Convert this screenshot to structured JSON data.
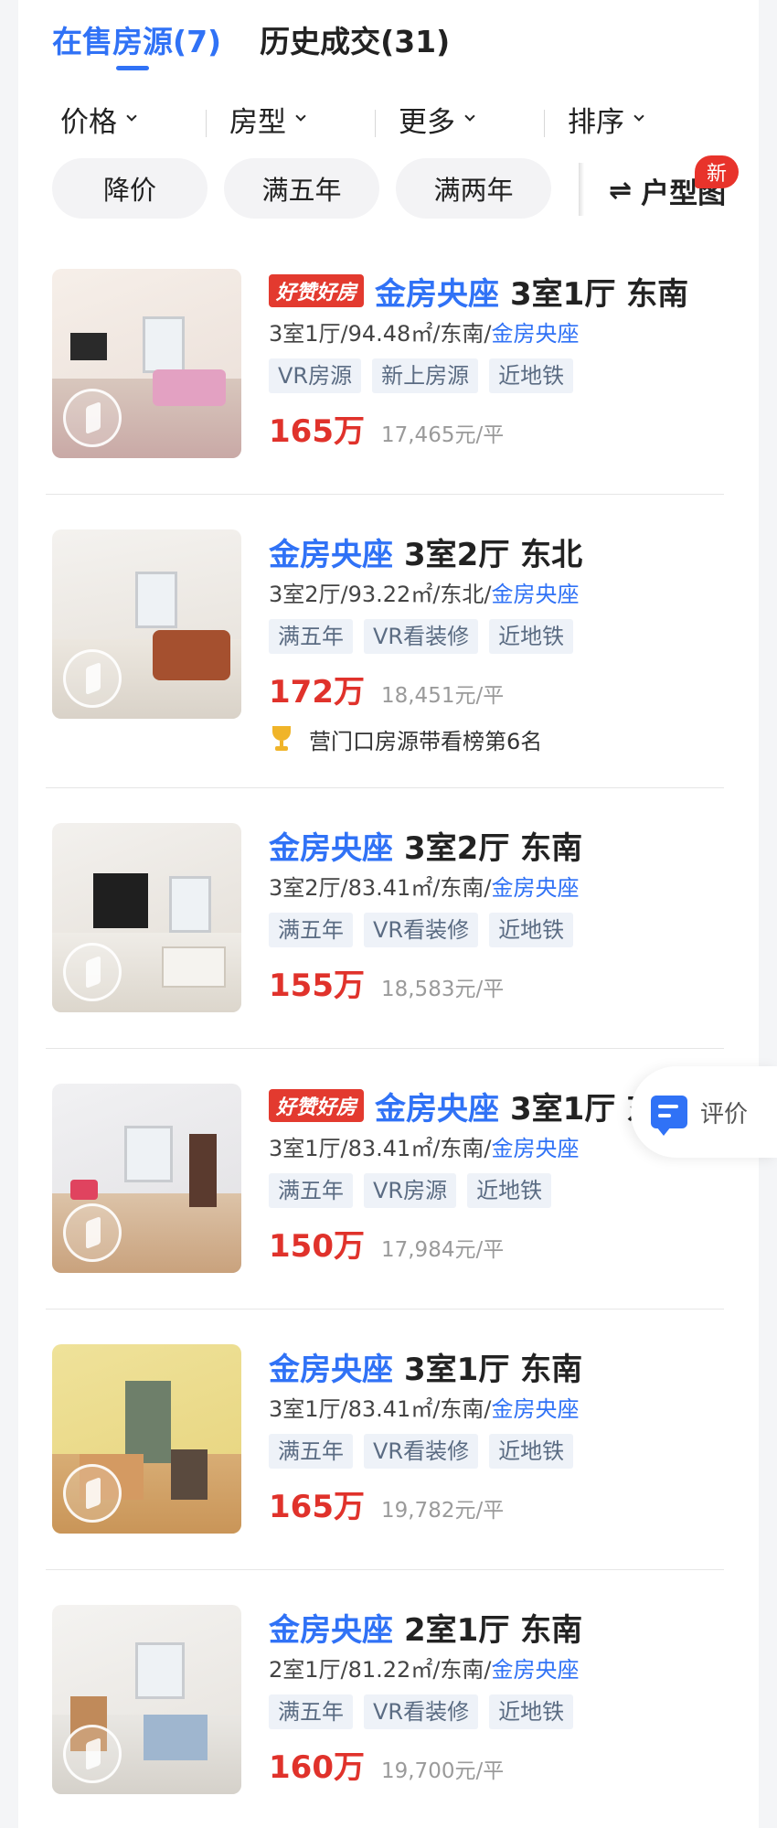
{
  "tabs": [
    {
      "label": "在售房源(7)",
      "active": true
    },
    {
      "label": "历史成交(31)",
      "active": false
    }
  ],
  "filters": [
    {
      "label": "价格"
    },
    {
      "label": "房型"
    },
    {
      "label": "更多"
    },
    {
      "label": "排序"
    }
  ],
  "chips": [
    {
      "label": "降价"
    },
    {
      "label": "满五年"
    },
    {
      "label": "满两年"
    }
  ],
  "floorplan": {
    "icon": "swap-icon",
    "label": "户型图",
    "badge": "新"
  },
  "listings": [
    {
      "hot_badge": "好赞好房",
      "community": "金房央座",
      "layout": "3室1厅 东南",
      "detail_prefix": "3室1厅/94.48㎡/东南/",
      "detail_community": "金房央座",
      "tags": [
        "VR房源",
        "新上房源",
        "近地铁"
      ],
      "price": "165万",
      "unit_price": "17,465元/平"
    },
    {
      "hot_badge": "",
      "community": "金房央座",
      "layout": "3室2厅 东北",
      "detail_prefix": "3室2厅/93.22㎡/东北/",
      "detail_community": "金房央座",
      "tags": [
        "满五年",
        "VR看装修",
        "近地铁"
      ],
      "price": "172万",
      "unit_price": "18,451元/平",
      "rank": "营门口房源带看榜第6名"
    },
    {
      "hot_badge": "",
      "community": "金房央座",
      "layout": "3室2厅 东南",
      "detail_prefix": "3室2厅/83.41㎡/东南/",
      "detail_community": "金房央座",
      "tags": [
        "满五年",
        "VR看装修",
        "近地铁"
      ],
      "price": "155万",
      "unit_price": "18,583元/平"
    },
    {
      "hot_badge": "好赞好房",
      "community": "金房央座",
      "layout": "3室1厅 东南",
      "detail_prefix": "3室1厅/83.41㎡/东南/",
      "detail_community": "金房央座",
      "tags": [
        "满五年",
        "VR房源",
        "近地铁"
      ],
      "price": "150万",
      "unit_price": "17,984元/平"
    },
    {
      "hot_badge": "",
      "community": "金房央座",
      "layout": "3室1厅 东南",
      "detail_prefix": "3室1厅/83.41㎡/东南/",
      "detail_community": "金房央座",
      "tags": [
        "满五年",
        "VR看装修",
        "近地铁"
      ],
      "price": "165万",
      "unit_price": "19,782元/平"
    },
    {
      "hot_badge": "",
      "community": "金房央座",
      "layout": "2室1厅 东南",
      "detail_prefix": "2室1厅/81.22㎡/东南/",
      "detail_community": "金房央座",
      "tags": [
        "满五年",
        "VR看装修",
        "近地铁"
      ],
      "price": "160万",
      "unit_price": "19,700元/平"
    }
  ],
  "review_button": {
    "icon": "comment-icon",
    "label": "评价"
  },
  "colors": {
    "accent": "#3072f6",
    "price": "#e0322b",
    "hot_badge": "#e33a2f",
    "new_badge": "#e8332b"
  }
}
